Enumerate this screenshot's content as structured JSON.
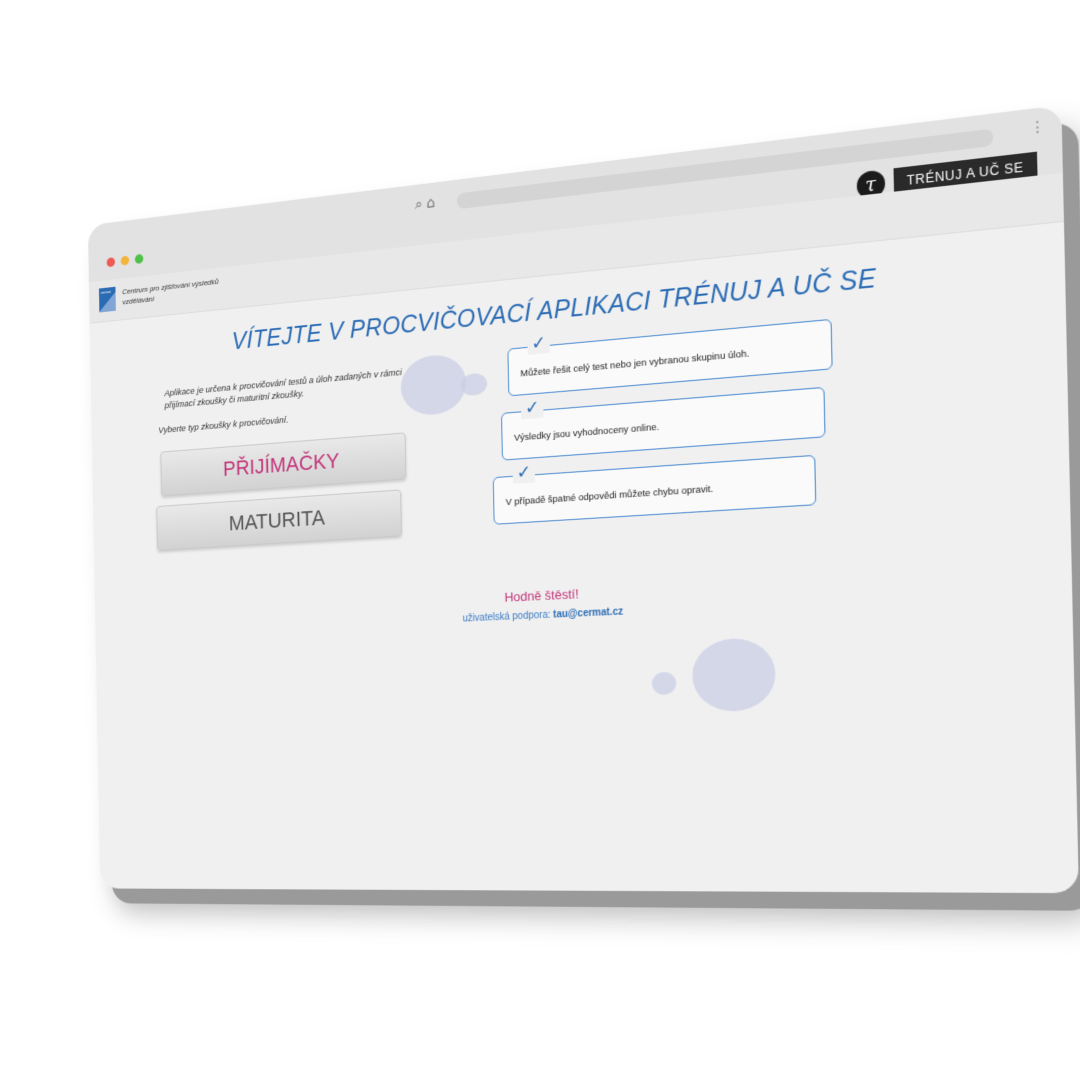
{
  "browser": {
    "window_controls": [
      "close",
      "minimize",
      "maximize"
    ],
    "address_icons": [
      "search-icon",
      "home-icon"
    ],
    "address_text": "",
    "app_badge": {
      "logo_glyph": "τ",
      "name": "TRÉNUJ A UČ SE"
    }
  },
  "site_header": {
    "org_name": "Centrum pro zjišťování výsledků vzdělávání",
    "logo_text": "cermat"
  },
  "main": {
    "title": "VÍTEJTE V PROCVIČOVACÍ APLIKACI TRÉNUJ A UČ SE",
    "intro": "Aplikace je určena k procvičování testů a úloh zadaných v rámci přijímací zkoušky či maturitní zkoušky.",
    "choose_prompt": "Vyberte typ zkoušky k procvičování.",
    "exam_buttons": [
      {
        "label": "PŘIJÍMAČKY"
      },
      {
        "label": "MATURITA"
      }
    ],
    "features": [
      {
        "text": "Můžete řešit celý test nebo jen vybranou skupinu úloh."
      },
      {
        "text": "Výsledky jsou vyhodnoceny online."
      },
      {
        "text": "V případě špatné odpovědi můžete chybu opravit."
      }
    ],
    "good_luck": "Hodně štěstí!",
    "support_label": "uživatelská podpora:",
    "support_email": "tau@cermat.cz"
  },
  "brand_word": {
    "part1": "cer",
    "part2": "mat"
  },
  "colors": {
    "brand_blue": "#2a6bb4",
    "brand_magenta": "#c2357a",
    "feature_border": "#4a8ad0"
  }
}
